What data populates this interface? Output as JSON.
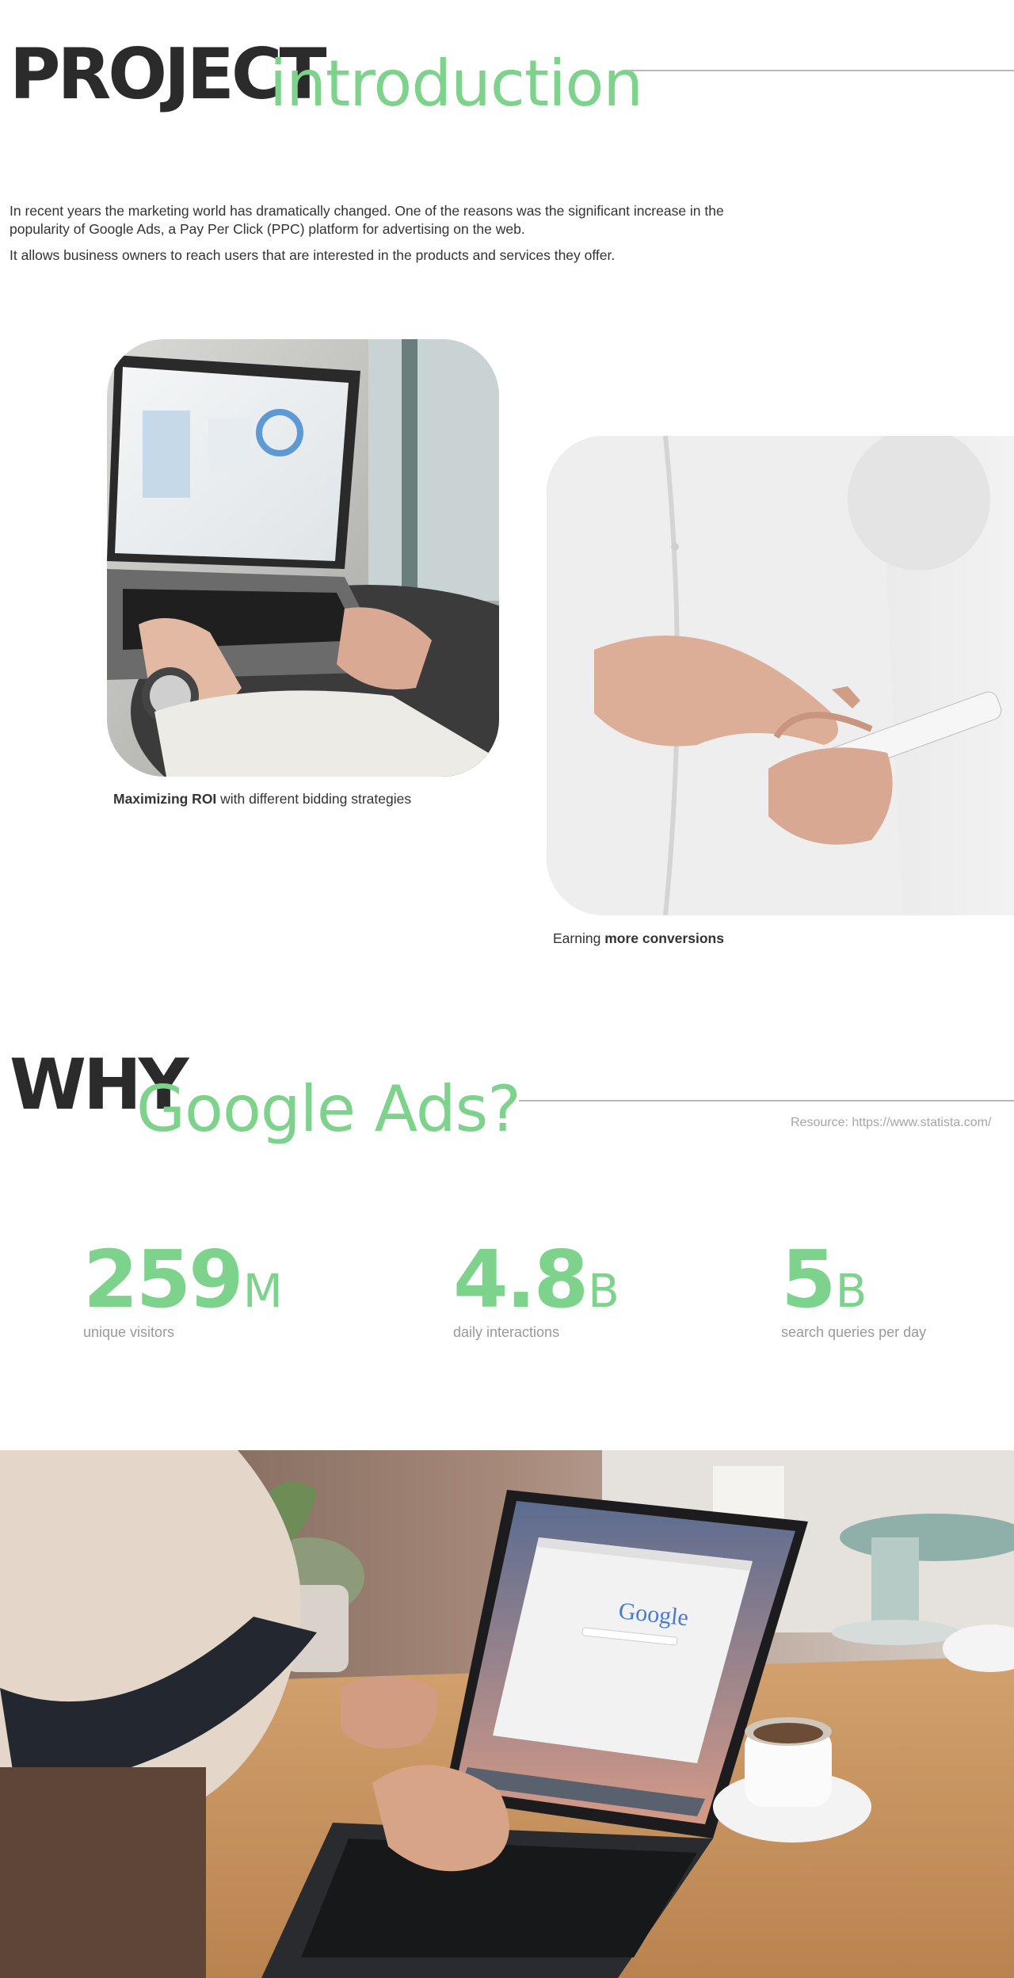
{
  "intro": {
    "heading_bold": "PROJECT",
    "heading_light": "introduction",
    "paragraph_1": "In recent years the marketing world has dramatically changed. One of the reasons was the significant increase in the popularity of Google Ads, a  Pay Per Click (PPC) platform for advertising on the web.",
    "paragraph_2": "It allows business owners to reach users that are interested in the products and services they offer."
  },
  "gallery": {
    "left_caption_bold": "Maximizing ROI",
    "left_caption_rest": " with different bidding strategies",
    "right_caption_rest": "Earning ",
    "right_caption_bold": "more conversions"
  },
  "why": {
    "heading_bold": "WHY",
    "heading_light": "Google Ads?",
    "resource": "Resource: https://www.statista.com/"
  },
  "stats": [
    {
      "number": "259",
      "unit": "M",
      "label": "unique visitors"
    },
    {
      "number": "4.8",
      "unit": "B",
      "label": "daily interactions"
    },
    {
      "number": "5",
      "unit": "B",
      "label": "search queries per day"
    }
  ],
  "hero": {
    "screen_logo": "Google"
  },
  "colors": {
    "accent_green": "#7dd38c",
    "heading_dark": "#2b2b2b",
    "muted_text": "#9a9a9a"
  }
}
